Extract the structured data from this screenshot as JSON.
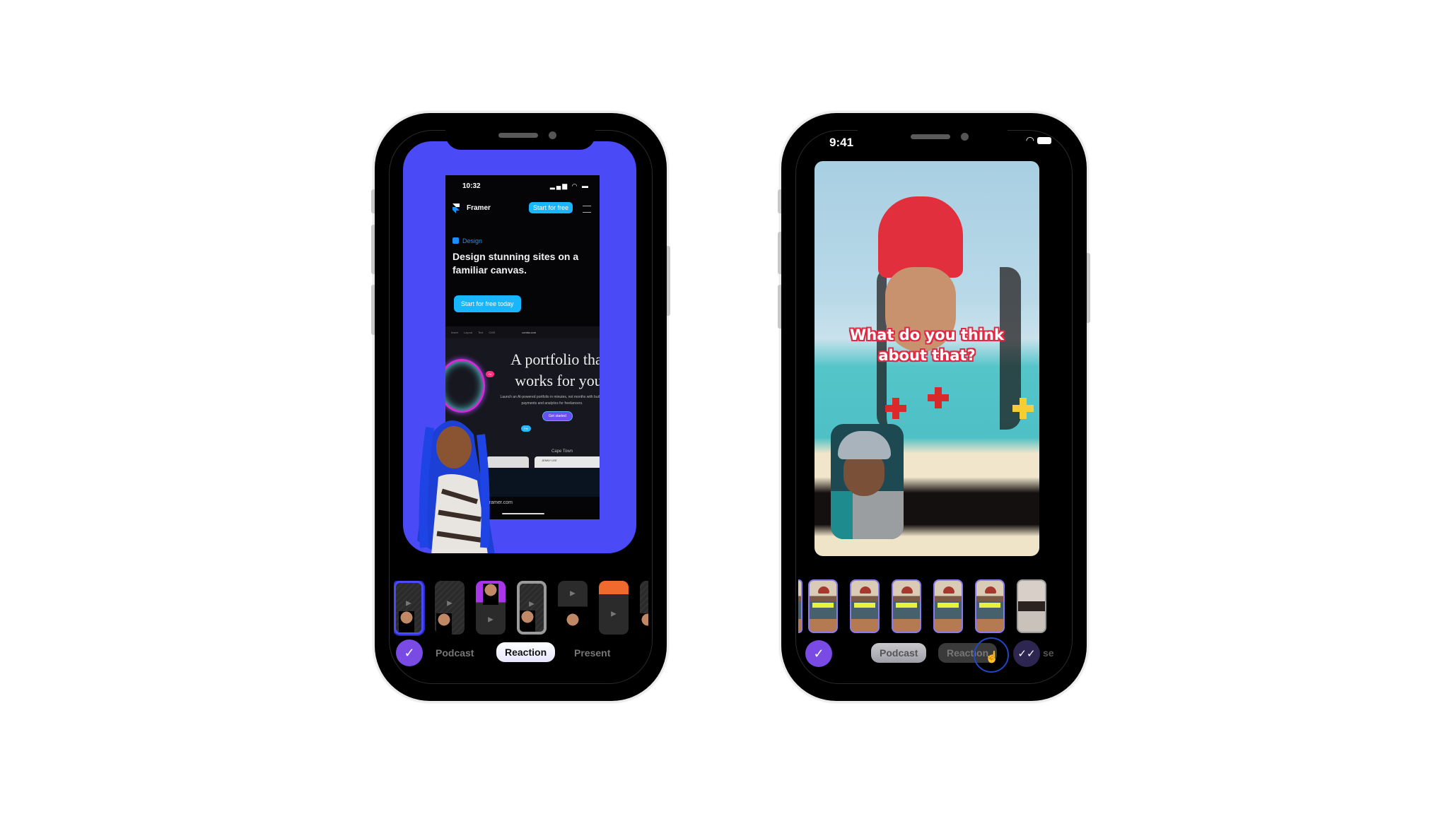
{
  "left_phone": {
    "web_screenshot": {
      "status_time": "10:32",
      "status_icons": "signal wifi battery",
      "brand": "Framer",
      "nav_cta": "Start for free",
      "tag": "Design",
      "headline": "Design stunning sites on a familiar canvas.",
      "cta": "Start for free today",
      "toolbar_items": [
        "Insert",
        "Layout",
        "Text",
        "CMS"
      ],
      "toolbar_url": "contra.com",
      "portfolio_title_line1": "A portfolio that",
      "portfolio_title_line2": "works for you",
      "portfolio_sub": "Launch an AI-powered portfolio in minutes, not months with built in payments and analytics for freelancers.",
      "get_started": "Get started",
      "pill_blue": "Fel",
      "pill_pink": "Dr",
      "location": "Cape Town",
      "card_name": "JENNY LEE",
      "footer_url": "framer.com"
    },
    "background_color": "#4a4af7",
    "thumbnails": [
      {
        "label": "Reaction layout 1",
        "selected": true
      },
      {
        "label": "Reaction layout 2",
        "selected": false
      },
      {
        "label": "Reaction layout 3",
        "selected": false
      },
      {
        "label": "Reaction layout 4",
        "selected": false
      },
      {
        "label": "Reaction layout 5",
        "selected": false
      },
      {
        "label": "Reaction layout 6",
        "selected": false
      },
      {
        "label": "Reaction layout 7",
        "selected": false
      }
    ],
    "modes": {
      "confirm_icon": "check-icon",
      "podcast": "Podcast",
      "reaction": "Reaction",
      "present": "Present",
      "active": "Reaction"
    }
  },
  "right_phone": {
    "status_time": "9:41",
    "caption_line1": "What do you think",
    "caption_line2": "about that?",
    "thumbnails": [
      {
        "label": "Caption style partial"
      },
      {
        "label": "Caption style 1"
      },
      {
        "label": "Caption style 2"
      },
      {
        "label": "Caption style 3"
      },
      {
        "label": "Caption style 4"
      },
      {
        "label": "Caption style 5"
      },
      {
        "label": "Caption style 6"
      }
    ],
    "modes": {
      "confirm_icon": "check-icon",
      "podcast": "Podcast",
      "reaction": "Reaction",
      "done_icon": "double-check-icon",
      "cut_label": "se"
    },
    "accent_color": "#7a4be4"
  }
}
